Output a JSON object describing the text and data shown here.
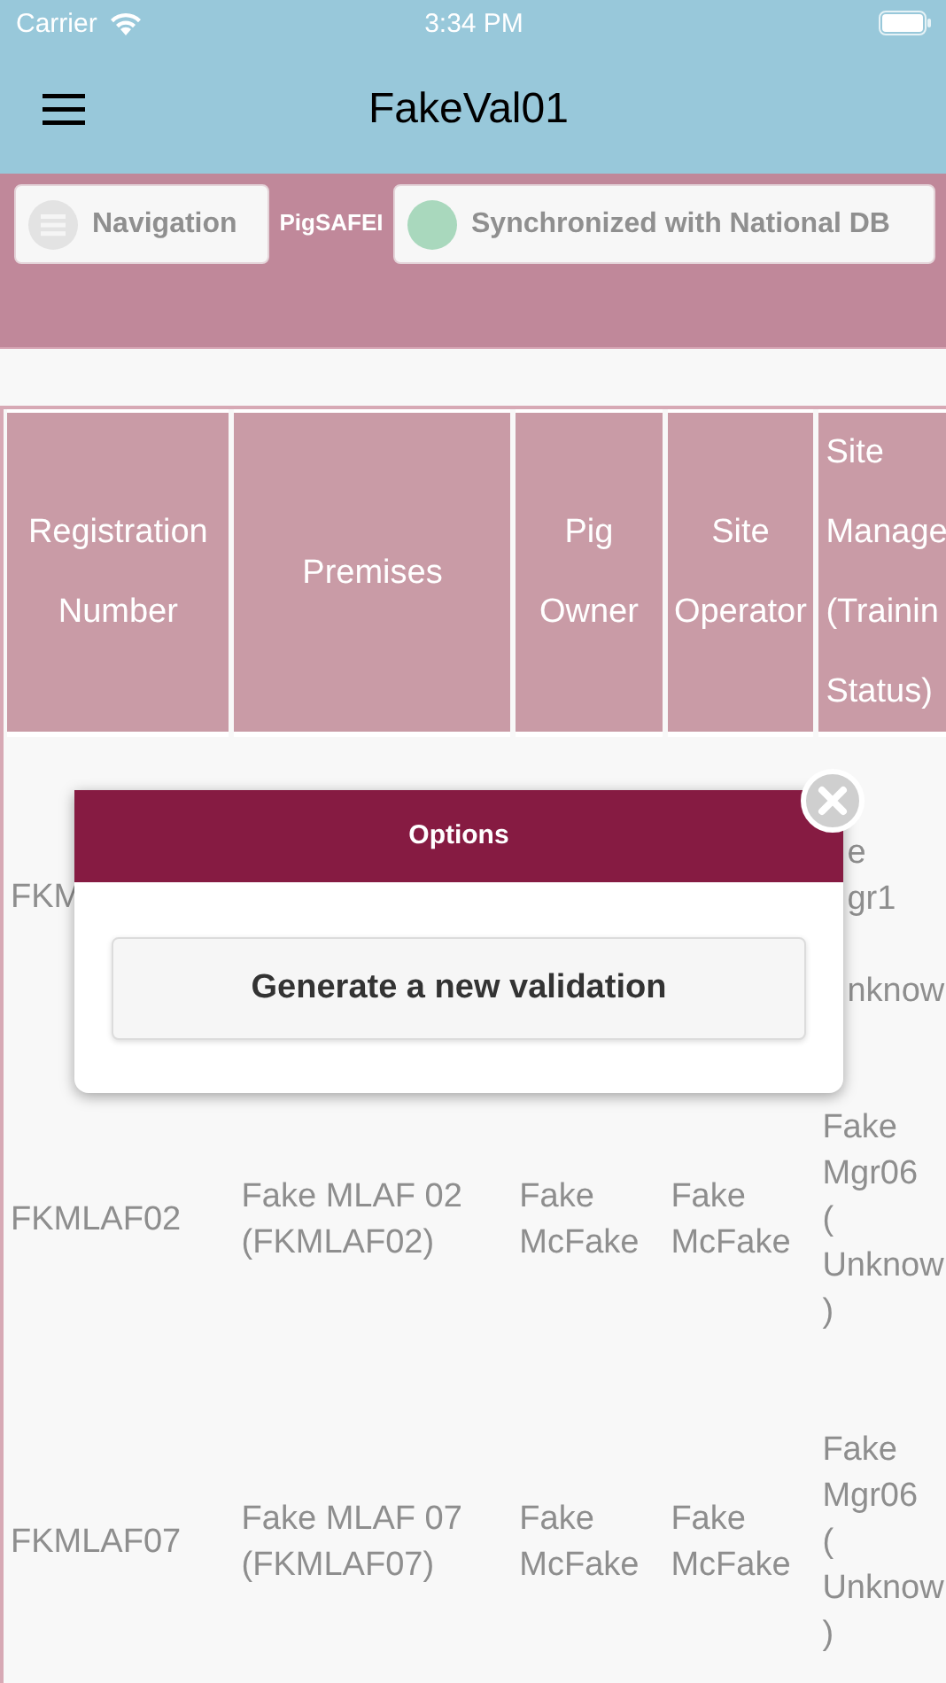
{
  "status_bar": {
    "carrier": "Carrier",
    "time": "3:34 PM"
  },
  "navbar": {
    "title": "FakeVal01"
  },
  "toolbar": {
    "navigation_button": "Navigation",
    "brand": "PigSAFEI",
    "sync_button": "Synchronized with National DB"
  },
  "table": {
    "columns": [
      "Registration Number",
      "Premises",
      "Pig Owner",
      "Site Operator",
      "Site\nManage\n(Trainin\nStatus)"
    ],
    "rows": [
      {
        "registration_number": "FKM",
        "site_manager": "e\ngr1\n\nnknow"
      },
      {
        "registration_number": "FKMLAF02",
        "premises": "Fake MLAF 02 (FKMLAF02)",
        "pig_owner": "Fake McFake",
        "site_operator": "Fake McFake",
        "site_manager": "Fake\nMgr06\n(\nUnknow\n)"
      },
      {
        "registration_number": "FKMLAF07",
        "premises": "Fake MLAF 07 (FKMLAF07)",
        "pig_owner": "Fake McFake",
        "site_operator": "Fake McFake",
        "site_manager": "Fake\nMgr06\n(\nUnknow\n)"
      }
    ]
  },
  "popup": {
    "title": "Options",
    "buttons": [
      "Generate a new validation"
    ]
  }
}
